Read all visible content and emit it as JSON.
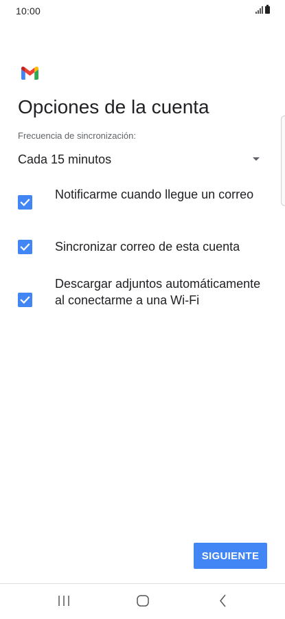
{
  "status_bar": {
    "time": "10:00"
  },
  "app": {
    "logo_icon": "gmail-m-logo",
    "title": "Opciones de la cuenta"
  },
  "sync": {
    "label": "Frecuencia de sincronización:",
    "selected": "Cada 15 minutos"
  },
  "options": [
    {
      "label": "Notificarme cuando llegue un correo",
      "checked": true
    },
    {
      "label": "Sincronizar correo de esta cuenta",
      "checked": true
    },
    {
      "label": "Descargar adjuntos automáticamente al conectarme a una Wi-Fi",
      "checked": true
    }
  ],
  "next_button": {
    "label": "SIGUIENTE"
  },
  "colors": {
    "accent": "#4285f4",
    "text": "#202124",
    "secondary_text": "#5f6368"
  },
  "nav_bar": {
    "recents_icon": "recents-icon",
    "home_icon": "home-icon",
    "back_icon": "back-icon"
  }
}
